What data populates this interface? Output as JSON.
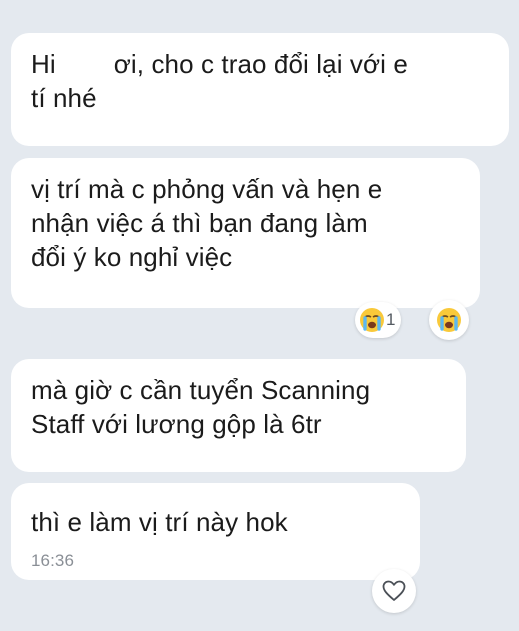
{
  "messages": [
    {
      "line1_pre": "Hi",
      "line1_post": "ơi, cho c trao đổi lại với e",
      "line2": "tí nhé"
    },
    {
      "lines": [
        "vị trí mà c phỏng vấn và hẹn e",
        "nhận việc á thì bạn đang làm",
        "đổi ý ko nghỉ việc"
      ]
    },
    {
      "lines": [
        "mà giờ c cần tuyển Scanning",
        "Staff với lương gộp là 6tr"
      ]
    },
    {
      "text": "thì e làm vị trí này hok",
      "time": "16:36"
    }
  ],
  "reactions": {
    "crying_count": "1",
    "crying_icon": "loudly-crying-face-icon",
    "add_icon": "heart-outline-icon"
  },
  "colors": {
    "background": "#e4e9ef",
    "bubble": "#ffffff",
    "text": "#1b1b1b",
    "time": "#8a8f96"
  }
}
